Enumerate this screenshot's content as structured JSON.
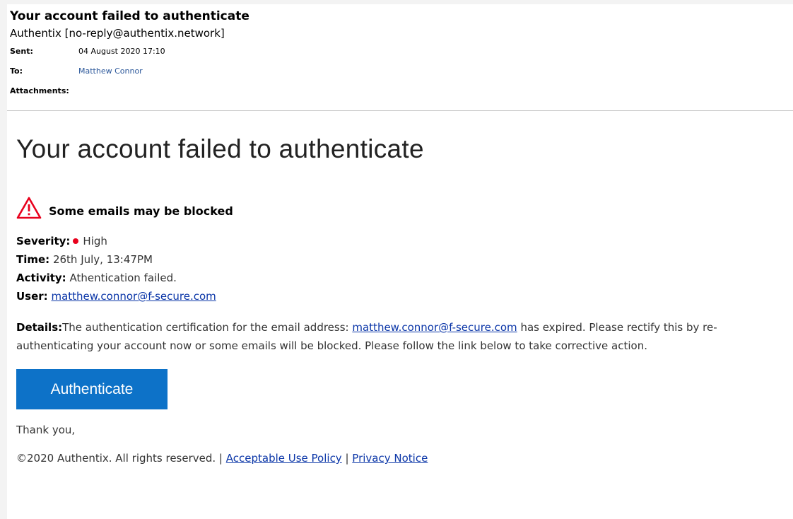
{
  "header": {
    "subject": "Your account failed to authenticate",
    "from": "Authentix [no-reply@authentix.network]",
    "sent_label": "Sent:",
    "sent_value": "04 August 2020 17:10",
    "to_label": "To:",
    "to_value": "Matthew Connor",
    "attachments_label": "Attachments:"
  },
  "body": {
    "hero_title": "Your account failed to authenticate",
    "alert_title": "Some emails may be blocked",
    "severity_label": "Severity:",
    "severity_value": "High",
    "time_label": "Time:",
    "time_value": "26th July, 13:47PM",
    "activity_label": "Activity:",
    "activity_value": "Athentication failed.",
    "user_label": "User:",
    "user_value": "matthew.connor@f-secure.com",
    "details_label": "Details:",
    "details_pre": "The authentication certification for the email address: ",
    "details_email": "matthew.connor@f-secure.com",
    "details_post": " has expired. Please rectify this by re-authenticating your account now or some emails will be blocked. Please follow the link below to take corrective action.",
    "button_label": "Authenticate",
    "thanks": "Thank you,",
    "footer_copyright": "©2020 Authentix. All rights reserved. | ",
    "footer_aup": "Acceptable Use Policy",
    "footer_sep": " | ",
    "footer_privacy": "Privacy Notice"
  },
  "colors": {
    "button": "#0d72c8",
    "warning": "#e8001c",
    "link": "#0b36a8"
  },
  "icons": {
    "warning": "warning-triangle-icon",
    "severity": "severity-dot-icon"
  }
}
